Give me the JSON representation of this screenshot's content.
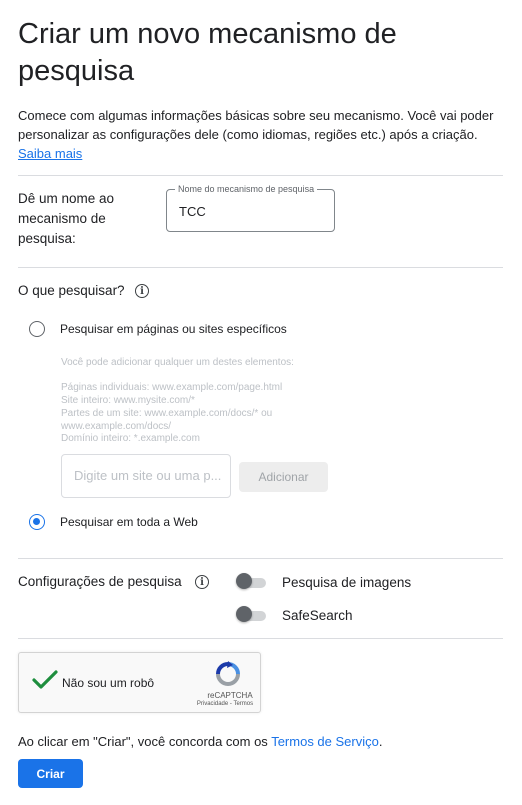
{
  "page": {
    "title": "Criar um novo mecanismo de pesquisa",
    "intro_text": "Comece com algumas informações básicas sobre seu mecanismo. Você vai poder personalizar as configurações dele (como idiomas, regiões etc.) após a criação.",
    "learn_more": "Saiba mais"
  },
  "name_section": {
    "label": "Dê um nome ao mecanismo de pesquisa:",
    "field_label": "Nome do mecanismo de pesquisa",
    "field_value": "TCC"
  },
  "what_section": {
    "heading": "O que pesquisar?",
    "option_sites": {
      "label": "Pesquisar em páginas ou sites específicos",
      "selected": false
    },
    "hint_intro": "Você pode adicionar qualquer um destes elementos:",
    "hints": [
      "Páginas individuais: www.example.com/page.html",
      "Site inteiro: www.mysite.com/*",
      "Partes de um site: www.example.com/docs/* ou www.example.com/docs/",
      "Domínio inteiro: *.example.com"
    ],
    "site_input_placeholder": "Digite um site ou uma p...",
    "add_button": "Adicionar",
    "option_web": {
      "label": "Pesquisar em toda a Web",
      "selected": true
    }
  },
  "settings_section": {
    "heading": "Configurações de pesquisa",
    "toggles": [
      {
        "label": "Pesquisa de imagens",
        "on": false
      },
      {
        "label": "SafeSearch",
        "on": false
      }
    ]
  },
  "captcha": {
    "label": "Não sou um robô",
    "brand": "reCAPTCHA",
    "links": "Privacidade - Termos",
    "checked": true
  },
  "footer": {
    "terms_prefix": "Ao clicar em \"Criar\", você concorda com os ",
    "terms_link": "Termos de Serviço",
    "terms_suffix": ".",
    "create_button": "Criar"
  },
  "colors": {
    "accent": "#1a73e8",
    "check_green": "#1e8e3e",
    "text": "#202124",
    "divider": "#dadce0"
  }
}
